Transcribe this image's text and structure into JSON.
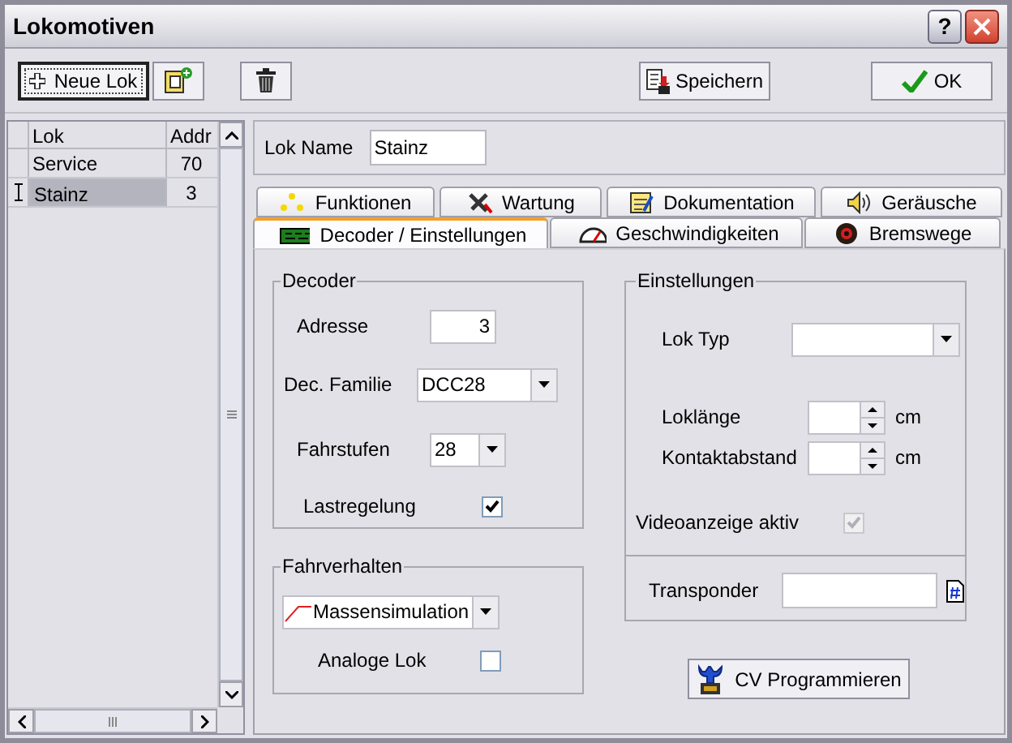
{
  "window": {
    "title": "Lokomotiven",
    "help_button": "?"
  },
  "toolbar": {
    "new_button": "Neue Lok",
    "save_button": "Speichern",
    "ok_button": "OK"
  },
  "lok_list": {
    "columns": [
      "Lok",
      "Addr"
    ],
    "rows": [
      {
        "name": "Service",
        "addr": "70",
        "selected": false
      },
      {
        "name": "Stainz",
        "addr": "3",
        "selected": true
      }
    ]
  },
  "lok_name": {
    "label": "Lok Name",
    "value": "Stainz"
  },
  "tabs": [
    [
      {
        "label": "Funktionen",
        "selected": false
      },
      {
        "label": "Wartung",
        "selected": false
      },
      {
        "label": "Dokumentation",
        "selected": false
      },
      {
        "label": "Geräusche",
        "selected": false
      }
    ],
    [
      {
        "label": "Decoder / Einstellungen",
        "selected": true
      },
      {
        "label": "Geschwindigkeiten",
        "selected": false
      },
      {
        "label": "Bremswege",
        "selected": false
      }
    ]
  ],
  "decoder": {
    "title": "Decoder",
    "fields": [
      {
        "kind": "text",
        "label": "Adresse",
        "value": "3"
      },
      {
        "kind": "select",
        "label": "Dec. Familie",
        "value": "DCC28"
      },
      {
        "kind": "select",
        "label": "Fahrstufen",
        "value": "28"
      },
      {
        "kind": "checkbox",
        "label": "Lastregelung",
        "checked": true,
        "disabled": false
      }
    ]
  },
  "fahrverhalten": {
    "title": "Fahrverhalten",
    "mode": "Massensimulation",
    "analog": {
      "label": "Analoge Lok",
      "checked": false,
      "disabled": false
    }
  },
  "einstellungen": {
    "title": "Einstellungen",
    "fields": [
      {
        "kind": "select",
        "label": "Lok Typ"
      },
      {
        "kind": "spinner",
        "label": "Loklänge",
        "unit": "cm"
      },
      {
        "kind": "spinner",
        "label": "Kontaktabstand",
        "unit": "cm"
      },
      {
        "kind": "checkbox",
        "label": "Videoanzeige aktiv",
        "checked": true,
        "disabled": true
      }
    ],
    "transponder_label": "Transponder"
  },
  "cv_button": "CV Programmieren"
}
